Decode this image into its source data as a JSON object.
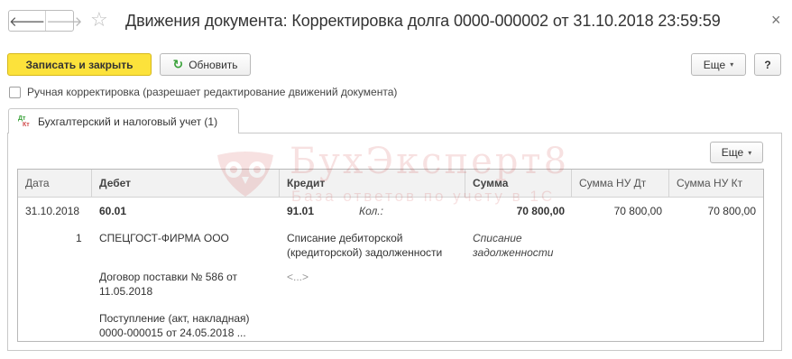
{
  "window": {
    "title": "Движения документа: Корректировка долга 0000-000002 от 31.10.2018 23:59:59",
    "back_glyph": "🡐",
    "forward_glyph": "🡒",
    "star_glyph": "☆",
    "close_glyph": "×"
  },
  "toolbar": {
    "save_close_label": "Записать и закрыть",
    "refresh_label": "Обновить",
    "refresh_glyph": "↻",
    "more_label": "Еще",
    "help_label": "?",
    "caret": "▾"
  },
  "manual_edit": {
    "label": "Ручная корректировка (разрешает редактирование движений документа)",
    "checked": false
  },
  "tab": {
    "icon_top": "Дт",
    "icon_bottom": "Кт",
    "label": "Бухгалтерский и налоговый учет (1)"
  },
  "panel": {
    "more_label": "Еще",
    "caret": "▾"
  },
  "watermark": {
    "title": "БухЭксперт8",
    "subtitle": "База ответов по учету в 1С"
  },
  "table": {
    "columns": [
      "Дата",
      "Дебет",
      "Кредит",
      "Сумма",
      "Сумма НУ Дт",
      "Сумма НУ Кт"
    ],
    "row": {
      "date": "31.10.2018",
      "number": "1",
      "debit_account": "60.01",
      "debit_sub1": "СПЕЦГОСТ-ФИРМА ООО",
      "debit_sub2_line1": "Договор поставки № 586 от",
      "debit_sub2_line2": "11.05.2018",
      "debit_sub3_line1": "Поступление (акт, накладная)",
      "debit_sub3_line2": "0000-000015 от 24.05.2018 ...",
      "credit_account": "91.01",
      "credit_qty_label": "Кол.:",
      "credit_sub1_line1": "Списание дебиторской",
      "credit_sub1_line2": "(кредиторской) задолженности",
      "credit_sub2": "<...>",
      "amount": "70 800,00",
      "content_line1": "Списание",
      "content_line2": "задолженности",
      "amount_nu_dt": "70 800,00",
      "amount_nu_kt": "70 800,00"
    }
  }
}
